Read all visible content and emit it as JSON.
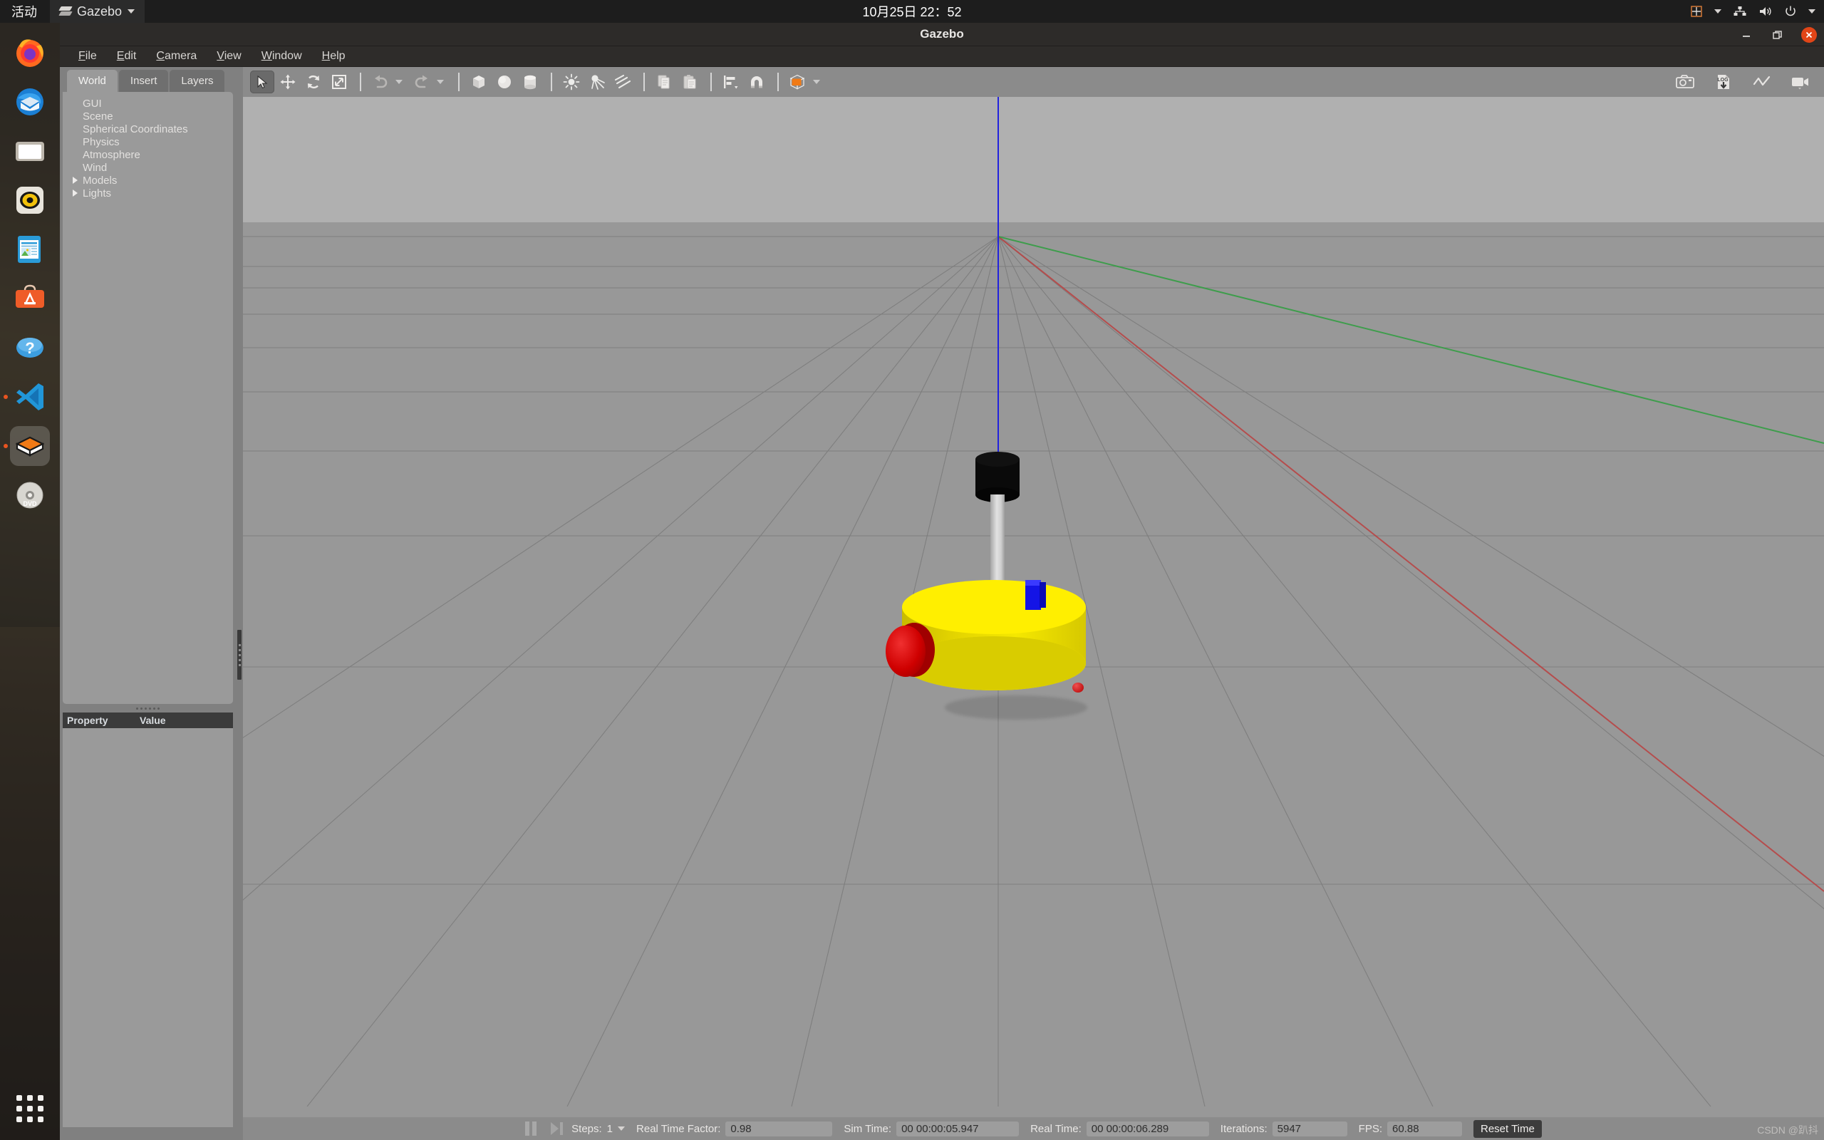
{
  "os_topbar": {
    "activities_label": "活动",
    "app_name": "Gazebo",
    "app_icon": "gazebo-logo-icon",
    "clock": "10月25日  22：52",
    "tray_icons": [
      "input-method-icon",
      "network-icon",
      "volume-icon",
      "power-icon",
      "chevron-down-icon"
    ]
  },
  "dock": {
    "items": [
      {
        "name": "firefox",
        "label": "Firefox",
        "active": false,
        "running": false
      },
      {
        "name": "thunderbird",
        "label": "Thunderbird",
        "active": false,
        "running": false
      },
      {
        "name": "files",
        "label": "Files",
        "active": false,
        "running": false
      },
      {
        "name": "rhythmbox",
        "label": "Rhythmbox",
        "active": false,
        "running": false
      },
      {
        "name": "libreoffice-writer",
        "label": "LibreOffice Writer",
        "active": false,
        "running": false
      },
      {
        "name": "ubuntu-software",
        "label": "Ubuntu Software",
        "active": false,
        "running": false
      },
      {
        "name": "help",
        "label": "Help",
        "active": false,
        "running": false
      },
      {
        "name": "vscode",
        "label": "Visual Studio Code",
        "active": false,
        "running": true
      },
      {
        "name": "gazebo",
        "label": "Gazebo",
        "active": true,
        "running": true
      },
      {
        "name": "dvd-drive",
        "label": "DVD",
        "active": false,
        "running": false
      }
    ],
    "show_apps_label": "Show Applications"
  },
  "window": {
    "title": "Gazebo",
    "controls": {
      "minimize": "−",
      "maximize": "❐",
      "close": "✕"
    }
  },
  "menubar": {
    "items": [
      {
        "label": "File",
        "mnemonic": "F"
      },
      {
        "label": "Edit",
        "mnemonic": "E"
      },
      {
        "label": "Camera",
        "mnemonic": "C"
      },
      {
        "label": "View",
        "mnemonic": "V"
      },
      {
        "label": "Window",
        "mnemonic": "W"
      },
      {
        "label": "Help",
        "mnemonic": "H"
      }
    ]
  },
  "left_panel": {
    "tabs": [
      {
        "label": "World",
        "active": true
      },
      {
        "label": "Insert",
        "active": false
      },
      {
        "label": "Layers",
        "active": false
      }
    ],
    "tree": [
      {
        "label": "GUI",
        "expandable": false
      },
      {
        "label": "Scene",
        "expandable": false
      },
      {
        "label": "Spherical Coordinates",
        "expandable": false
      },
      {
        "label": "Physics",
        "expandable": false
      },
      {
        "label": "Atmosphere",
        "expandable": false
      },
      {
        "label": "Wind",
        "expandable": false
      },
      {
        "label": "Models",
        "expandable": true
      },
      {
        "label": "Lights",
        "expandable": true
      }
    ],
    "property_table": {
      "columns": [
        "Property",
        "Value"
      ],
      "rows": []
    }
  },
  "toolbar": {
    "left_tools": [
      {
        "name": "select-mode-button",
        "icon": "cursor-arrow-icon",
        "active": true
      },
      {
        "name": "translate-mode-button",
        "icon": "move-arrows-icon",
        "active": false
      },
      {
        "name": "rotate-mode-button",
        "icon": "rotate-icon",
        "active": false
      },
      {
        "name": "scale-mode-button",
        "icon": "scale-icon",
        "active": false
      },
      {
        "name": "undo-button",
        "icon": "undo-arrow-icon",
        "active": false
      },
      {
        "name": "undo-history-button",
        "icon": "chevron-down-icon",
        "active": false
      },
      {
        "name": "redo-button",
        "icon": "redo-arrow-icon",
        "active": false
      },
      {
        "name": "redo-history-button",
        "icon": "chevron-down-icon",
        "active": false
      },
      {
        "name": "insert-box-button",
        "icon": "box-icon",
        "active": false
      },
      {
        "name": "insert-sphere-button",
        "icon": "sphere-icon",
        "active": false
      },
      {
        "name": "insert-cylinder-button",
        "icon": "cylinder-icon",
        "active": false
      },
      {
        "name": "insert-point-light-button",
        "icon": "point-light-icon",
        "active": false
      },
      {
        "name": "insert-spot-light-button",
        "icon": "spot-light-icon",
        "active": false
      },
      {
        "name": "insert-directional-light-button",
        "icon": "directional-light-icon",
        "active": false
      },
      {
        "name": "copy-button",
        "icon": "copy-icon",
        "active": false
      },
      {
        "name": "paste-button",
        "icon": "paste-icon",
        "active": false
      },
      {
        "name": "align-button",
        "icon": "align-icon",
        "active": false
      },
      {
        "name": "snap-button",
        "icon": "magnet-icon",
        "active": false
      },
      {
        "name": "view-angle-button",
        "icon": "view-cube-icon",
        "active": false
      }
    ],
    "right_tools": [
      {
        "name": "screenshot-button",
        "icon": "camera-icon"
      },
      {
        "name": "log-data-button",
        "icon": "log-download-icon"
      },
      {
        "name": "plot-button",
        "icon": "line-plot-icon"
      },
      {
        "name": "video-record-button",
        "icon": "video-camera-icon"
      }
    ],
    "accent_color": "#f07a16"
  },
  "statusbar": {
    "pause_icon": "pause-icon",
    "step_icon": "step-forward-icon",
    "steps_label": "Steps:",
    "steps_value": "1",
    "real_time_factor_label": "Real Time Factor:",
    "real_time_factor_value": "0.98",
    "sim_time_label": "Sim Time:",
    "sim_time_value": "00 00:00:05.947",
    "real_time_label": "Real Time:",
    "real_time_value": "00 00:00:06.289",
    "iterations_label": "Iterations:",
    "iterations_value": "5947",
    "fps_label": "FPS:",
    "fps_value": "60.88",
    "reset_time_label": "Reset Time"
  },
  "viewport": {
    "sky_color": "#b0b0b0",
    "ground_color": "#989898",
    "grid_color": "#7e7e7e",
    "axis_colors": {
      "x": "#cc3333",
      "y": "#2f9e3f",
      "z": "#2222dd"
    },
    "model": {
      "name": "mobile-robot",
      "base_color": "#ffef00",
      "lidar_color": "#0a0a0a",
      "pole_color": "#cfcfcf",
      "wheel_color": "#cf0000",
      "sensor_color": "#1414e6"
    }
  },
  "watermark": {
    "text": "CSDN @趴抖"
  }
}
